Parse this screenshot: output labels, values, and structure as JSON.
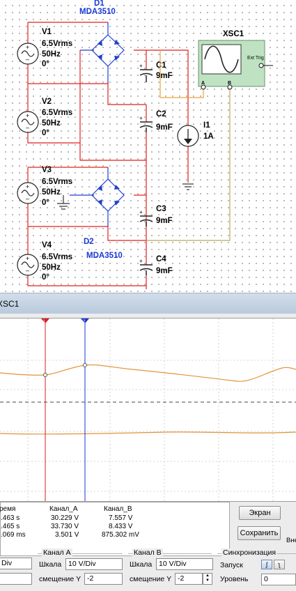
{
  "schematic": {
    "d1": {
      "name": "D1",
      "model": "MDA3510"
    },
    "d2": {
      "name": "D2",
      "model": "MDA3510"
    },
    "sources": [
      {
        "name": "V1",
        "amp": "6.5Vrms",
        "freq": "50Hz",
        "phase": "0°"
      },
      {
        "name": "V2",
        "amp": "6.5Vrms",
        "freq": "50Hz",
        "phase": "0°"
      },
      {
        "name": "V3",
        "amp": "6.5Vrms",
        "freq": "50Hz",
        "phase": "0°"
      },
      {
        "name": "V4",
        "amp": "6.5Vrms",
        "freq": "50Hz",
        "phase": "0°"
      }
    ],
    "caps": [
      {
        "name": "C1",
        "value": "9mF"
      },
      {
        "name": "C2",
        "value": "9mF"
      },
      {
        "name": "C3",
        "value": "9mF"
      },
      {
        "name": "C4",
        "value": "9mF"
      }
    ],
    "current_source": {
      "name": "I1",
      "value": "1A"
    },
    "scope": {
      "name": "XSC1",
      "ext_trig": "Ext Trig",
      "ch_a": "A",
      "ch_b": "B"
    }
  },
  "window": {
    "title": "XSC1"
  },
  "display": {
    "cursor1": "1",
    "cursor2": "2"
  },
  "measurements": {
    "headers": [
      "ремя",
      "Канал_A",
      "Канал_B"
    ],
    "rows": [
      [
        ".463 s",
        "30.229 V",
        "7.557 V"
      ],
      [
        ".465 s",
        "33.730 V",
        "8.433 V"
      ],
      [
        ".069 ms",
        "3.501 V",
        "875.302 mV"
      ]
    ]
  },
  "buttons": {
    "screen": "Экран",
    "save": "Сохранить",
    "external": "Вне"
  },
  "timebase": {
    "scale_value": "Div"
  },
  "channel_a": {
    "title": "Канал А",
    "scale_label": "Шкала",
    "scale_value": "10  V/Div",
    "offset_label": "смещение Y",
    "offset_value": "-2"
  },
  "channel_b": {
    "title": "Канал В",
    "scale_label": "Шкала",
    "scale_value": "10  V/Div",
    "offset_label": "смещение Y",
    "offset_value": "-2"
  },
  "trigger": {
    "title": "Синхронизация",
    "start_label": "Запуск",
    "level_label": "Уровень",
    "level_value": "0"
  },
  "colors": {
    "wire_red": "#e0201c",
    "wire_blue": "#1f3fd0",
    "wire_orange": "#e8a23c",
    "wire_olive": "#b9a95a",
    "trace": "#e2923a",
    "scope_panel": "#bfe3c2",
    "cursor_red": "#d81e1e",
    "cursor_blue": "#1c33d9"
  }
}
